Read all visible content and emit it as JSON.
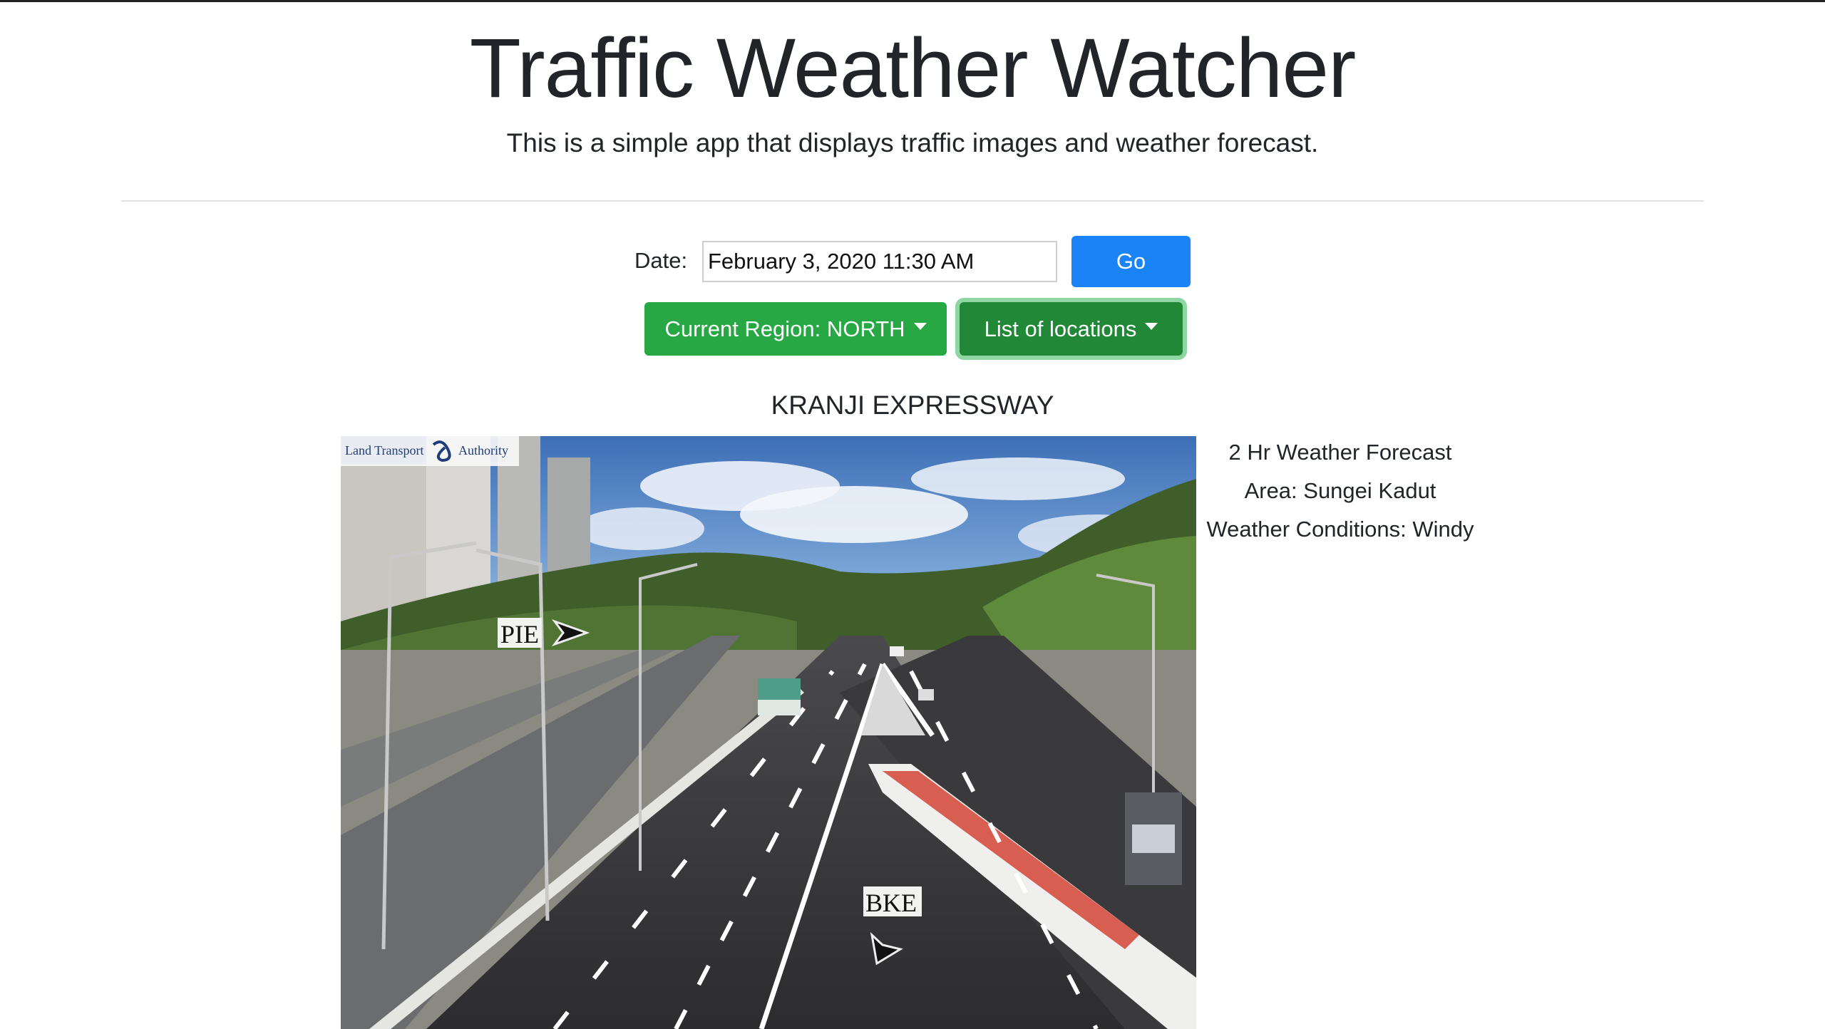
{
  "header": {
    "title": "Traffic Weather Watcher",
    "subtitle": "This is a simple app that displays traffic images and weather forecast."
  },
  "controls": {
    "date_label": "Date:",
    "date_value": "February 3, 2020 11:30 AM",
    "go_label": "Go",
    "region_label": "Current Region: NORTH",
    "locations_label": "List of locations"
  },
  "location": {
    "name": "KRANJI EXPRESSWAY"
  },
  "camera_image": {
    "watermark_left": "Land Transport",
    "watermark_right": "Authority",
    "sign_pie": "PIE",
    "sign_bke": "BKE"
  },
  "forecast": {
    "heading": "2 Hr Weather Forecast",
    "area": "Area: Sungei Kadut",
    "conditions": "Weather Conditions: Windy"
  },
  "colors": {
    "primary": "#1a84f6",
    "success": "#28a745",
    "success_active": "#218838"
  }
}
